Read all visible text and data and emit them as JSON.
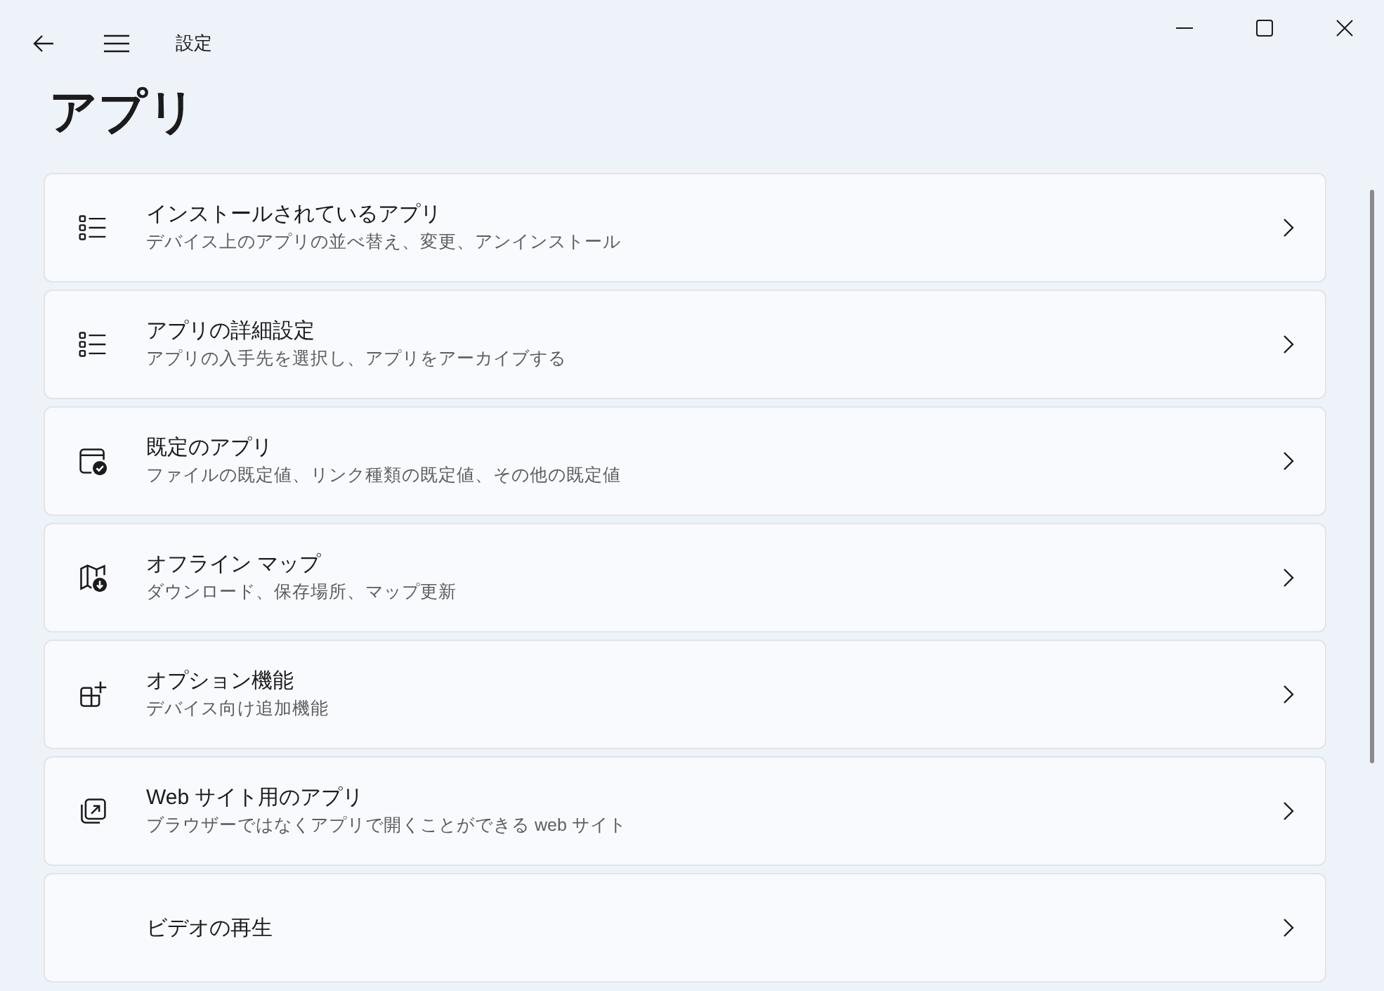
{
  "window": {
    "title": "設定"
  },
  "page_title": "アプリ",
  "items": [
    {
      "title": "インストールされているアプリ",
      "subtitle": "デバイス上のアプリの並べ替え、変更、アンインストール"
    },
    {
      "title": "アプリの詳細設定",
      "subtitle": "アプリの入手先を選択し、アプリをアーカイブする"
    },
    {
      "title": "既定のアプリ",
      "subtitle": "ファイルの既定値、リンク種類の既定値、その他の既定値"
    },
    {
      "title": "オフライン マップ",
      "subtitle": "ダウンロード、保存場所、マップ更新"
    },
    {
      "title": "オプション機能",
      "subtitle": "デバイス向け追加機能"
    },
    {
      "title": "Web サイト用のアプリ",
      "subtitle": "ブラウザーではなくアプリで開くことができる web サイト"
    },
    {
      "title": "ビデオの再生"
    }
  ]
}
